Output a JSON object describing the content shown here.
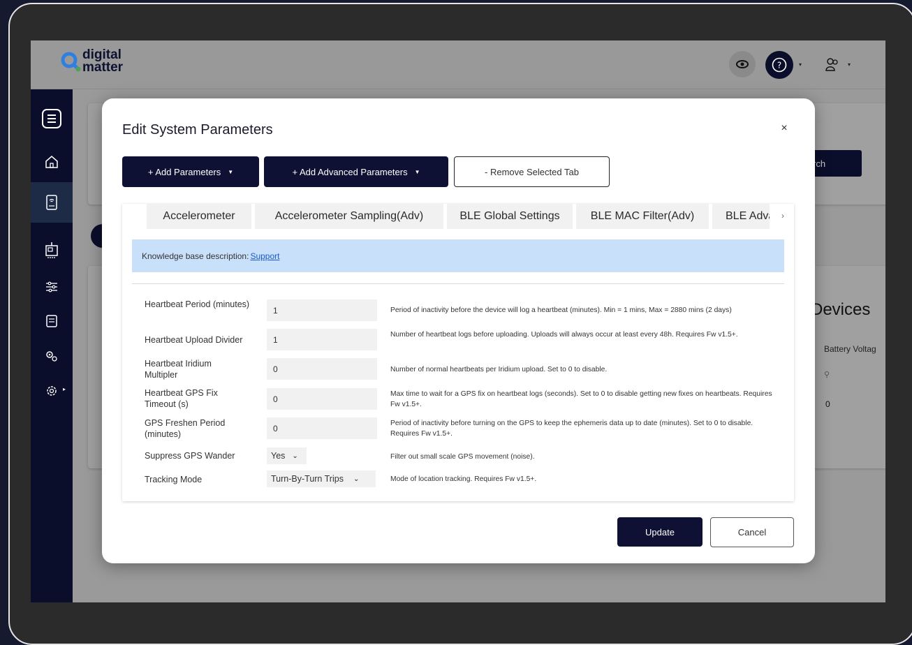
{
  "app": {
    "logo_line1": "digital",
    "logo_line2": "matter",
    "brand_color": "#0e1133",
    "accent_color": "#2f7fe3"
  },
  "background_page": {
    "search_button_fragment": "rch",
    "devices_heading_fragment": "Devices",
    "battery_col_fragment": "Battery Voltag",
    "cell_value": "0"
  },
  "modal": {
    "title": "Edit System Parameters",
    "close_label": "×",
    "add_params_label": "+ Add Parameters",
    "add_adv_params_label": "+ Add Advanced Parameters",
    "remove_tab_label": "- Remove Selected Tab",
    "tabs": [
      {
        "label": "Accelerometer"
      },
      {
        "label": "Accelerometer Sampling(Adv)"
      },
      {
        "label": "BLE Global Settings"
      },
      {
        "label": "BLE MAC Filter(Adv)"
      },
      {
        "label": "BLE Advanced"
      }
    ],
    "kb_prefix": "Knowledge base description:",
    "kb_link": "Support",
    "params": [
      {
        "label": "Heartbeat Period (minutes)",
        "value": "1",
        "description": "Period of inactivity before the device will log a heartbeat (minutes). Min = 1 mins, Max = 2880 mins (2 days)"
      },
      {
        "label": "Heartbeat Upload Divider",
        "value": "1",
        "description": "Number of heartbeat logs before uploading. Uploads will always occur at least every 48h. Requires Fw v1.5+."
      },
      {
        "label": "Heartbeat Iridium Multipler",
        "value": "0",
        "description": "Number of normal heartbeats per Iridium upload. Set to 0 to disable."
      },
      {
        "label": "Heartbeat GPS Fix Timeout (s)",
        "value": "0",
        "description": "Max time to wait for a GPS fix on heartbeat logs (seconds). Set to 0 to disable getting new fixes on heartbeats. Requires Fw v1.5+."
      },
      {
        "label": "GPS Freshen Period (minutes)",
        "value": "0",
        "description": "Period of inactivity before turning on the GPS to keep the ephemeris data up to date (minutes). Set to 0 to disable. Requires Fw v1.5+."
      },
      {
        "label": "Suppress GPS Wander",
        "value": "Yes",
        "description": "Filter out small scale GPS movement (noise)."
      },
      {
        "label": "Tracking Mode",
        "value": "Turn-By-Turn Trips",
        "description": "Mode of location tracking. Requires Fw v1.5+."
      }
    ],
    "update_label": "Update",
    "cancel_label": "Cancel"
  }
}
